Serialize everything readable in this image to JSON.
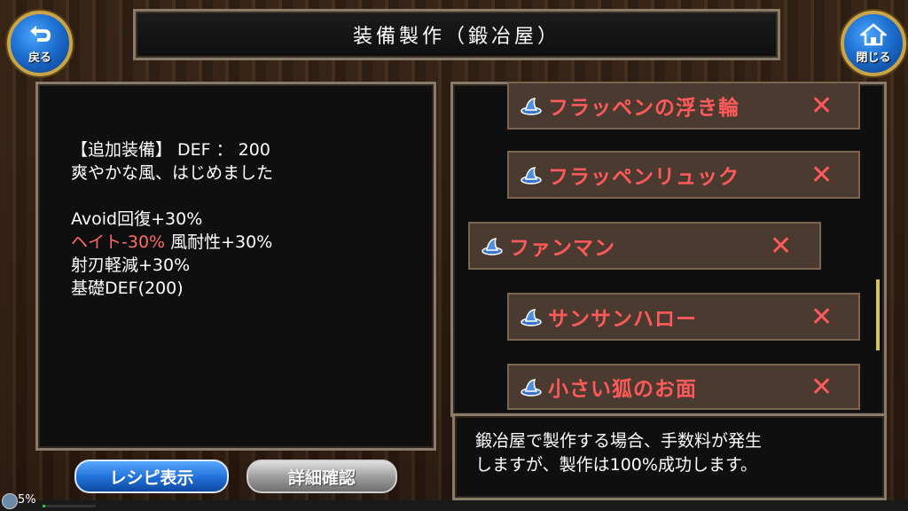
{
  "header": {
    "title": "装備製作（鍛冶屋）",
    "back_label": "戻る",
    "close_label": "閉じる"
  },
  "detail": {
    "line1": "【追加装備】 DEF ： 200",
    "line2": "爽やかな風、はじめました",
    "line3": "Avoid回復+30%",
    "line4_hate": "ヘイト-30%",
    "line4_rest": " 風耐性+30%",
    "line5": "射刃軽減+30%",
    "line6": "基礎DEF(200)"
  },
  "recipe_list": {
    "items": [
      {
        "name": "フラッペンの浮き輪",
        "mark": "✕"
      },
      {
        "name": "フラッペンリュック",
        "mark": "✕"
      },
      {
        "name": "ファンマン",
        "mark": "✕"
      },
      {
        "name": "サンサンハロー",
        "mark": "✕"
      },
      {
        "name": "小さい狐のお面",
        "mark": "✕"
      }
    ]
  },
  "info": {
    "line1": "鍛冶屋で製作する場合、手数料が発生",
    "line2": "しますが、製作は100%成功します。"
  },
  "buttons": {
    "recipe_label": "レシピ表示",
    "detail_label": "詳細確認"
  },
  "status": {
    "percent_label": "5%",
    "progress": 0.05
  },
  "colors": {
    "item_name": "#ff5a5a",
    "hate_text": "#ff6b6b",
    "panel_border": "#8a7a68"
  }
}
